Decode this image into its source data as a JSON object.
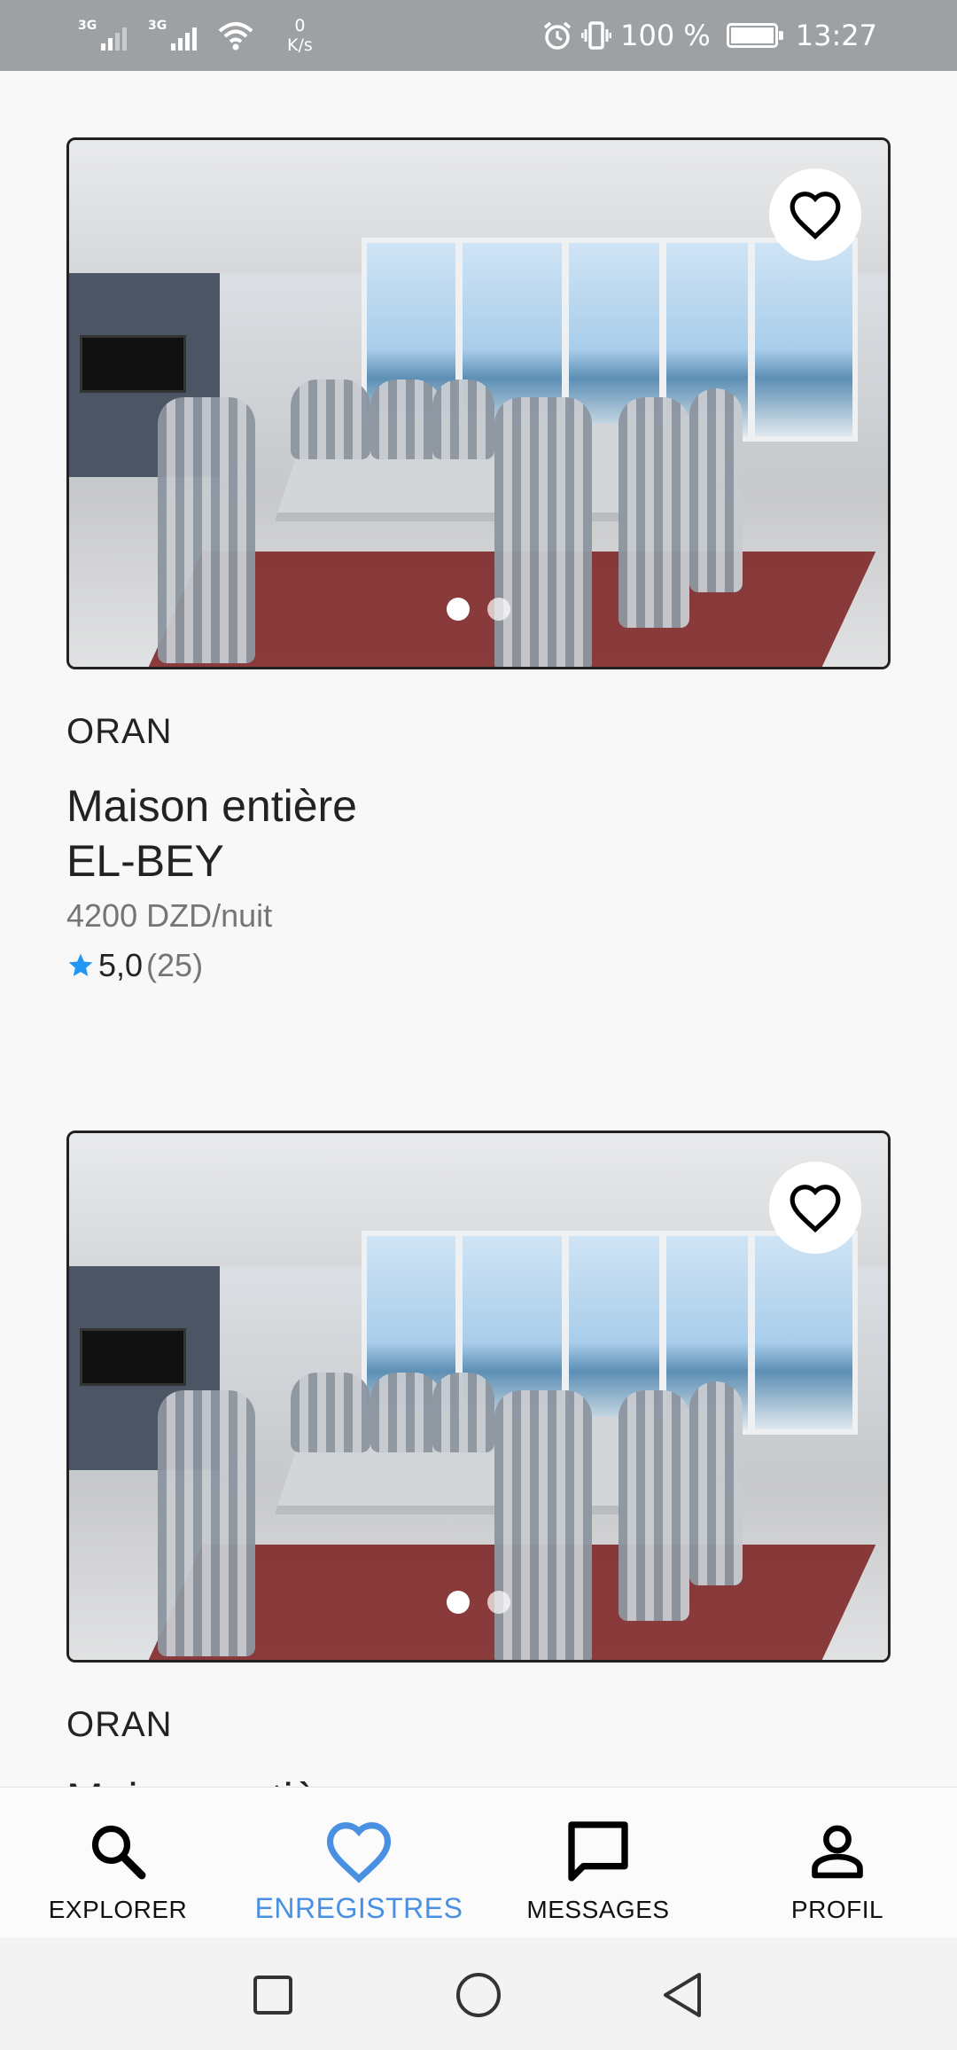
{
  "status_bar": {
    "network_1": "3G",
    "network_2": "3G",
    "speed_value": "0",
    "speed_unit": "K/s",
    "battery": "100 %",
    "time": "13:27"
  },
  "listings": [
    {
      "city": "ORAN",
      "title_line1": "Maison entière",
      "title_line2": "EL-BEY",
      "price": "4200 DZD/nuit",
      "rating": "5,0",
      "reviews": "(25)",
      "photo_count": 2,
      "active_photo": 1
    },
    {
      "city": "ORAN",
      "title_line1": "Maison entière",
      "photo_count": 2,
      "active_photo": 1
    }
  ],
  "bottom_nav": {
    "items": [
      {
        "label": "EXPLORER",
        "icon": "search-icon",
        "active": false
      },
      {
        "label": "ENREGISTRES",
        "icon": "heart-icon",
        "active": true
      },
      {
        "label": "MESSAGES",
        "icon": "chat-icon",
        "active": false
      },
      {
        "label": "PROFIL",
        "icon": "person-icon",
        "active": false
      }
    ]
  },
  "colors": {
    "accent": "#4a90e2",
    "star": "#2196f3",
    "status_bar": "#9ea1a3"
  }
}
